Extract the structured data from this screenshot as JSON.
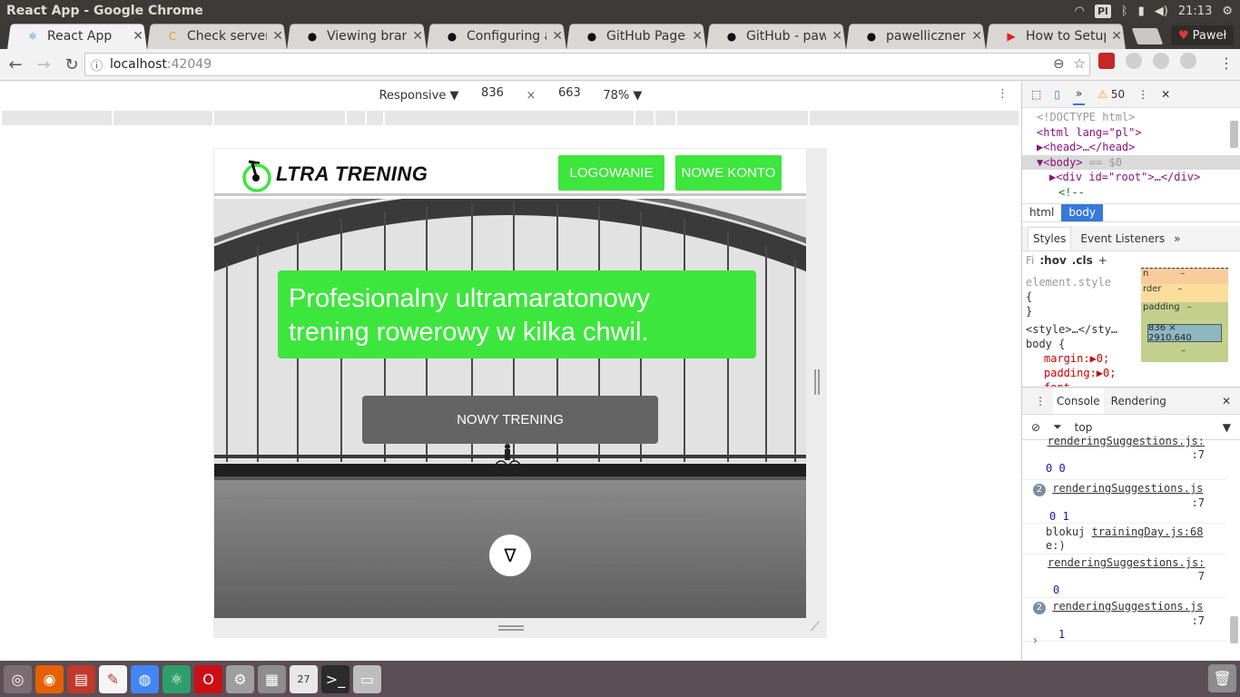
{
  "window": {
    "title": "React App - Google Chrome"
  },
  "tray": {
    "keyboard": "Pl",
    "time": "21:13"
  },
  "tabs": [
    {
      "label": "React App",
      "icon": "react-icon",
      "active": true
    },
    {
      "label": "Check server:",
      "icon": "codeship-icon"
    },
    {
      "label": "Viewing bran",
      "icon": "github-icon"
    },
    {
      "label": "Configuring a",
      "icon": "github-icon"
    },
    {
      "label": "GitHub Pages",
      "icon": "github-icon"
    },
    {
      "label": "GitHub - pawe",
      "icon": "github-icon"
    },
    {
      "label": "pawelliczner:",
      "icon": "github-icon"
    },
    {
      "label": "How to Setup",
      "icon": "youtube-icon"
    }
  ],
  "profile": {
    "name": "Paweł"
  },
  "address": {
    "host": "localhost",
    "port": ":42049"
  },
  "device_toolbar": {
    "mode": "Responsive",
    "width": "836",
    "height": "663",
    "zoom": "78%"
  },
  "site": {
    "logo_text": "LTRA TRENING",
    "login_label": "LOGOWANIE",
    "signup_label": "NOWE KONTO",
    "headline_line1": "Profesionalny ultramaratonowy",
    "headline_line2": "trening rowerowy w kilka chwil.",
    "cta_label": "NOWY TRENING",
    "scroll_icon": "∇"
  },
  "devtools": {
    "warnings": "50",
    "elements": {
      "doctype": "<!DOCTYPE html>",
      "html_open": "<html lang=\"pl\">",
      "head": "▶<head>…</head>",
      "body": "▼<body>",
      "body_marker": "== $0",
      "div_root": "▶<div id=\"root\">…</div>",
      "comment": "<!--"
    },
    "breadcrumbs": [
      "html",
      "body"
    ],
    "style_tabs": [
      "Styles",
      "Event Listeners"
    ],
    "styles": {
      "filter": "Fi",
      "hov": ":hov",
      "cls": ".cls",
      "element_style": "element.style",
      "brace_open": "{",
      "brace_close": "}",
      "source": "<style>…</sty…",
      "body_rule": "body {",
      "margin": "margin:▶0;",
      "padding": "padding:▶0;",
      "font": "font-"
    },
    "box_model": {
      "margin": "n",
      "border": "rder",
      "padding": "padding",
      "dash": "–",
      "content": "836 × 2910.640"
    },
    "drawer_tabs": [
      "Console",
      "Rendering"
    ],
    "console_context": "top",
    "console": [
      {
        "text": "",
        "link": "renderingSuggestions.js:",
        "line": ":7",
        "value": "0 0"
      },
      {
        "count": "2",
        "link": "renderingSuggestions.js",
        "line": ":7",
        "value": "0 1"
      },
      {
        "text": "blokuj",
        "link": "trainingDay.js:68",
        "extra": "e:)"
      },
      {
        "link": "renderingSuggestions.js:",
        "line": "7",
        "value": "0"
      },
      {
        "count": "2",
        "link": "renderingSuggestions.js",
        "line": ":7",
        "value": "1"
      }
    ]
  },
  "dock": [
    "ubuntu-icon",
    "firefox-icon",
    "files-icon",
    "writer-icon",
    "chrome-icon",
    "atom-icon",
    "opera-icon",
    "settings-icon",
    "calculator-icon",
    "calendar-icon",
    "terminal-icon",
    "drive-icon"
  ]
}
